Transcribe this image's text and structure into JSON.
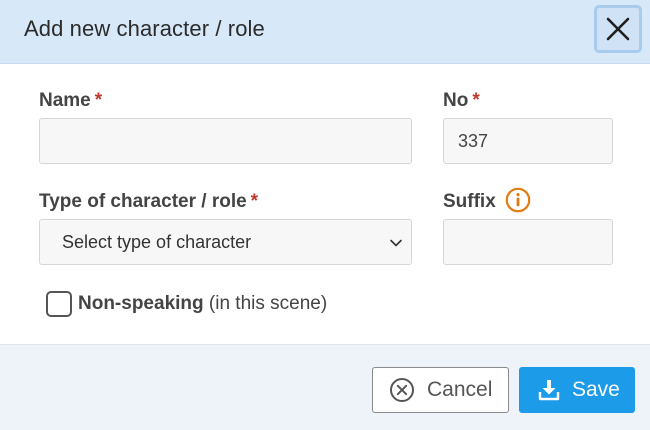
{
  "dialog": {
    "title": "Add new character / role",
    "close_icon": "close-icon"
  },
  "form": {
    "name": {
      "label": "Name",
      "required_mark": "*",
      "value": ""
    },
    "no": {
      "label": "No",
      "required_mark": "*",
      "value": "337"
    },
    "type": {
      "label": "Type of character / role",
      "required_mark": "*",
      "selected": "Select type of character"
    },
    "suffix": {
      "label": "Suffix",
      "info_icon": "info-icon",
      "value": ""
    },
    "non_speaking": {
      "label_strong": "Non-speaking",
      "label_rest": " (in this scene)",
      "checked": false
    }
  },
  "footer": {
    "cancel_label": "Cancel",
    "save_label": "Save"
  },
  "colors": {
    "header_bg": "#d7e8f8",
    "required": "#c0392b",
    "info": "#e07a12",
    "save_bg": "#1b9be8"
  }
}
